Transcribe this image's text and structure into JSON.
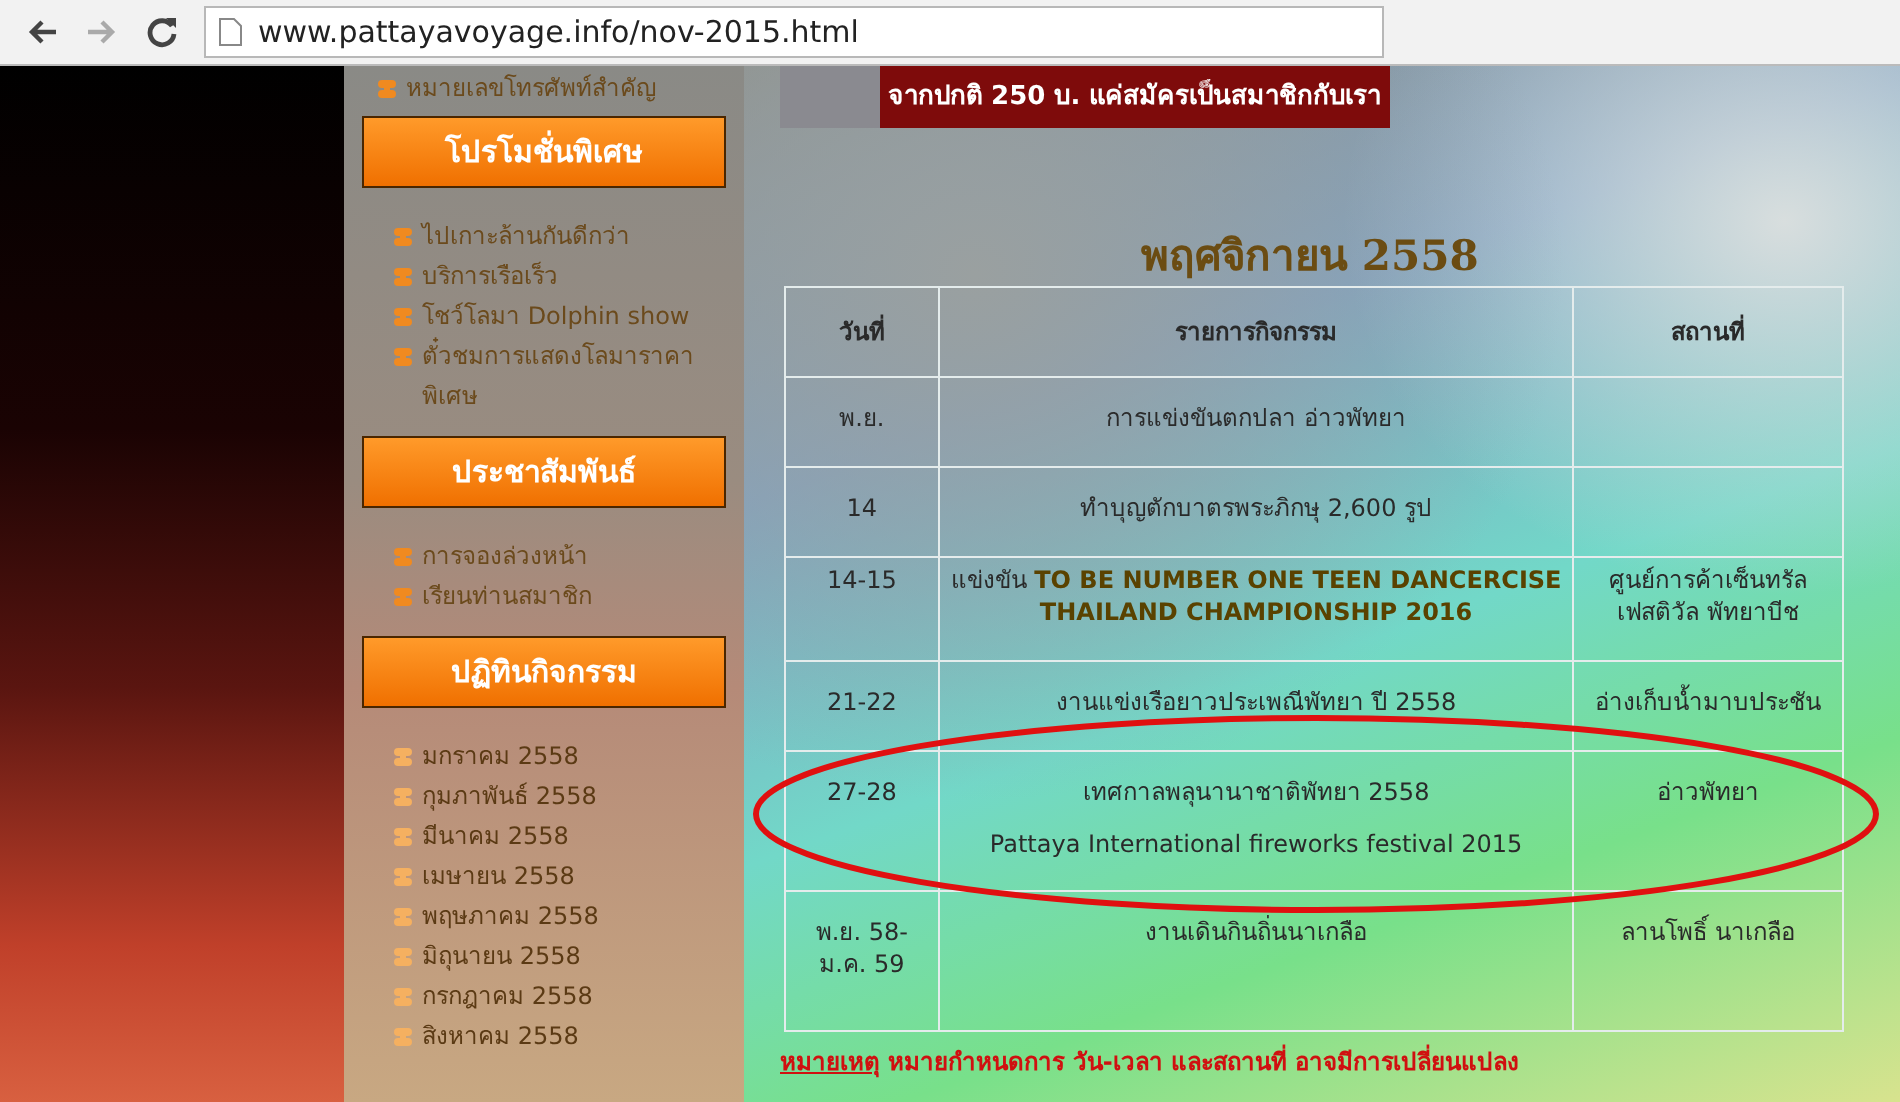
{
  "browser": {
    "url": "www.pattayavoyage.info/nov-2015.html"
  },
  "sidebar": {
    "top_item": "หมายเลขโทรศัพท์สำคัญ",
    "sections": [
      {
        "heading": "โปรโมชั่นพิเศษ",
        "kind": "links",
        "items": [
          "ไปเกาะล้านกันดีกว่า",
          "บริการเรือเร็ว",
          "โชว์โลมา Dolphin show",
          "ตั๋วชมการแสดงโลมาราคาพิเศษ"
        ]
      },
      {
        "heading": "ประชาสัมพันธ์",
        "kind": "links",
        "items": [
          "การจองล่วงหน้า",
          "เรียนท่านสมาชิก"
        ]
      },
      {
        "heading": "ปฏิทินกิจกรรม",
        "kind": "months",
        "items": [
          "มกราคม 2558",
          "กุมภาพันธ์ 2558",
          "มีนาคม 2558",
          "เมษายน 2558",
          "พฤษภาคม 2558",
          "มิถุนายน 2558",
          "กรกฎาคม 2558",
          "สิงหาคม 2558"
        ]
      }
    ]
  },
  "banner": {
    "text": "จากปกติ 250 บ. แค่สมัครเป็นสมาชิกกับเรา"
  },
  "title": "พฤศจิกายน 2558",
  "table": {
    "columns": [
      "วันที่",
      "รายการกิจกรรม",
      "สถานที่"
    ],
    "rows": [
      {
        "date": "พ.ย.",
        "activity": [
          "การแข่งขันตกปลา อ่าวพัทยา"
        ],
        "place": "",
        "highlighted": false
      },
      {
        "date": "14",
        "activity": [
          "ทำบุญตักบาตรพระภิกษุ 2,600 รูป"
        ],
        "place": "",
        "highlighted": false
      },
      {
        "date": "14-15",
        "activity": [
          "แข่งขัน **TO BE NUMBER ONE TEEN DANCERCISE THAILAND CHAMPIONSHIP 2016**"
        ],
        "place": "ศูนย์การค้าเซ็นทรัล เฟสติวัล พัทยาบีช",
        "highlighted": false
      },
      {
        "date": "21-22",
        "activity": [
          "งานแข่งเรือยาวประเพณีพัทยา ปี 2558"
        ],
        "place": "อ่างเก็บน้ำมาบประชัน",
        "highlighted": false
      },
      {
        "date": "27-28",
        "activity": [
          "เทศกาลพลุนานาชาติพัทยา 2558",
          "Pattaya International fireworks festival 2015"
        ],
        "place": "อ่าวพัทยา",
        "highlighted": true
      },
      {
        "date": "พ.ย. 58-ม.ค. 59",
        "activity": [
          "งานเดินกินถิ่นนาเกลือ"
        ],
        "place": "ลานโพธิ์ นาเกลือ",
        "highlighted": false
      }
    ]
  },
  "note": {
    "label": "หมายเหตุ",
    "text": "หมายกำหนดการ วัน-เวลา และสถานที่ อาจมีการเปลี่ยนแปลง"
  }
}
